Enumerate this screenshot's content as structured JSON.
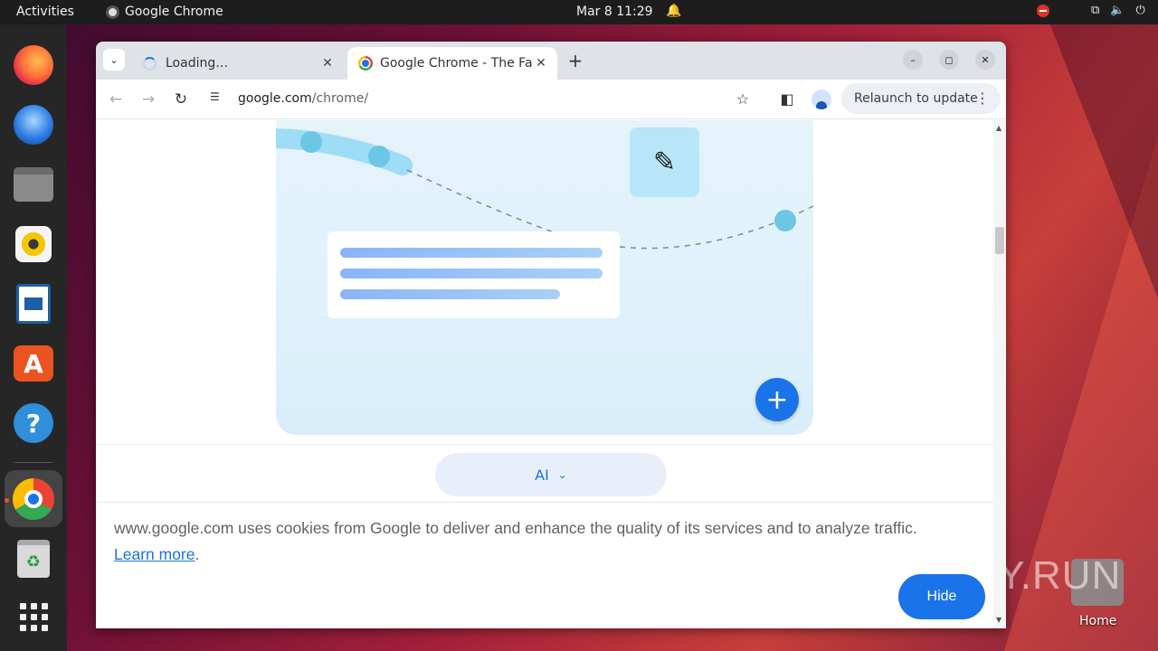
{
  "topbar": {
    "activities": "Activities",
    "app_name": "Google Chrome",
    "clock": "Mar 8  11:29"
  },
  "dock": {
    "items": [
      "firefox",
      "thunderbird",
      "files",
      "rhythmbox",
      "libreoffice-writer",
      "app-center",
      "help",
      "google-chrome",
      "trash",
      "show-apps"
    ]
  },
  "desktop": {
    "home_label": "Home",
    "watermark": "ANY.RUN"
  },
  "browser": {
    "tabs": [
      {
        "title": "Loading…",
        "state": "loading"
      },
      {
        "title": "Google Chrome - The Fast & Secure Web Browser",
        "state": "active"
      }
    ],
    "url_host": "google.com",
    "url_path": "/chrome/",
    "relaunch_label": "Relaunch to update"
  },
  "page": {
    "ai_pill_label": "AI",
    "cookie_message": "www.google.com uses cookies from Google to deliver and enhance the quality of its services and to analyze traffic.",
    "learn_more": "Learn more",
    "hide_label": "Hide"
  },
  "colors": {
    "accent": "#1a73e8",
    "ubuntu_orange": "#e95420",
    "hero_bg": "#dff1fb"
  }
}
